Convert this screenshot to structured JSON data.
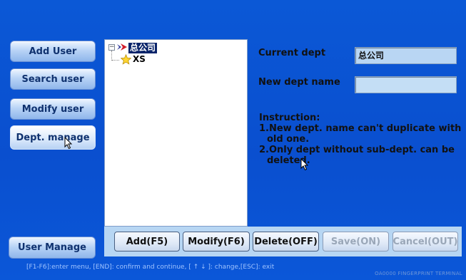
{
  "sidebar": {
    "items": [
      {
        "label": "Add User"
      },
      {
        "label": "Search user"
      },
      {
        "label": "Modify user"
      },
      {
        "label": "Dept. manage"
      }
    ],
    "bottom_label": "User Manage"
  },
  "tree": {
    "root": "总公司",
    "children": [
      "XS"
    ]
  },
  "form": {
    "current_dept_label": "Current dept",
    "current_dept_value": "总公司",
    "new_dept_label": "New dept name",
    "new_dept_value": ""
  },
  "instructions": {
    "title": "Instruction:",
    "line1a": "1.New dept. name can't duplicate with",
    "line1b": "old one.",
    "line2a": "2.Only dept without sub-dept. can be",
    "line2b": "deleted."
  },
  "buttons": {
    "add": "Add(F5)",
    "modify": "Modify(F6)",
    "delete": "Delete(OFF)",
    "save": "Save(ON)",
    "cancel": "Cancel(OUT)"
  },
  "status": {
    "help": "[F1-F6]:enter menu, [END]: confirm and continue, [ ↑ ↓ ]: change,[ESC]: exit",
    "brand": "OA0000 FINGERPRINT TERMINAL"
  },
  "colors": {
    "background": "#0a4fcf",
    "panel": "#b7d6f3",
    "selected": "#0a246a"
  }
}
